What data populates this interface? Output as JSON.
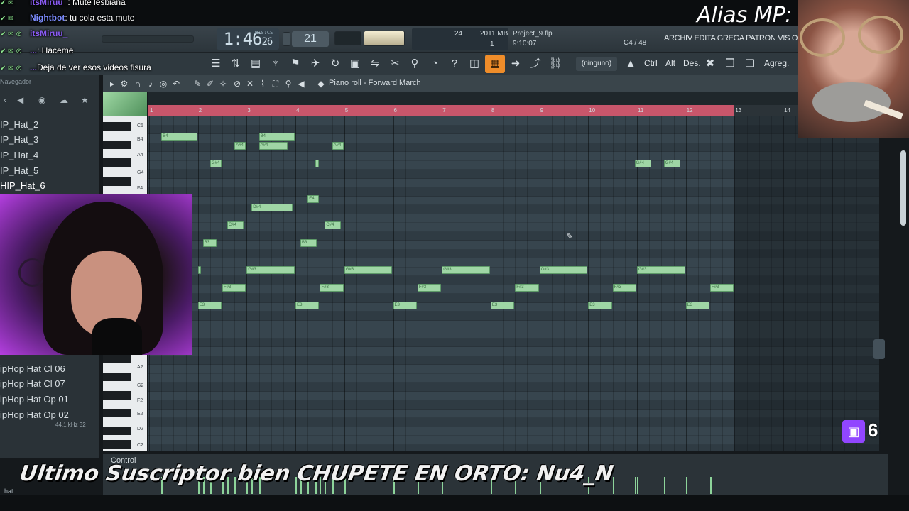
{
  "overlay": {
    "chat": [
      {
        "badges": "✔ ✉",
        "user": "itsMiruu_",
        "user_color": "#8b5cf6",
        "message": ": Mute lesbiana"
      },
      {
        "badges": "✔ ✉",
        "user": "Nightbot",
        "user_color": "#7c8cff",
        "message": ": tu cola esta mute"
      },
      {
        "badges": "✔ ✉ ⊘",
        "user": "itsMiruu_",
        "user_color": "#8b5cf6",
        "message": ""
      },
      {
        "badges": "✔ ✉ ⊘",
        "user": "...",
        "user_color": "#8b5cf6",
        "message": ": Haceme"
      },
      {
        "badges": "✔ ✉ ⊘",
        "user": "...",
        "user_color": "#8b5cf6",
        "message": "Deja de ver esos videos fisura"
      }
    ],
    "alias_text": "Alias MP: c",
    "subscriber_banner": "Ultimo Suscriptor bien CHUPETE EN ORTO: Nu4_N",
    "viewer_count": "6",
    "twitch_icon": "twitch-logo-icon"
  },
  "fl_toolbar": {
    "song_time": "1:46",
    "song_time_ticks": "26",
    "time_format_label": "M:S:CS",
    "tempo_value": "21",
    "cpu": "24",
    "ram": "2011 MB",
    "polyphony": "1",
    "project_name": "Project_9.flp",
    "project_time": "9:10:07",
    "note_info": "C4 / 48",
    "menu": "ARCHIV EDITA GREGA PATRON VIS OPCIONES",
    "pattern_selector": "(ninguno)",
    "text_buttons": [
      "Ctrl",
      "Alt",
      "Des.",
      "Agreg."
    ]
  },
  "browser": {
    "header": "Navegador",
    "items_top": [
      "IP_Hat_2",
      "IP_Hat_3",
      "IP_Hat_4",
      "IP_Hat_5",
      "HIP_Hat_6"
    ],
    "selected_index": 4,
    "items_bottom": [
      "ipHop Hat Cl 06",
      "ipHop Hat Cl 07",
      "ipHop Hat Op 01",
      "ipHop Hat Op 02"
    ],
    "meta": "44.1 kHz 32",
    "bottom_label": "hat"
  },
  "piano_roll": {
    "title": "Piano roll - Forward March",
    "control_label": "Control",
    "bars": [
      "1",
      "2",
      "3",
      "4",
      "5",
      "6",
      "7",
      "8",
      "9",
      "10",
      "11",
      "12",
      "13",
      "14"
    ],
    "key_labels": [
      "C5",
      "B4",
      "A4",
      "G4",
      "F4",
      "A2",
      "G2",
      "F2",
      "E2",
      "D2",
      "C2"
    ],
    "notes": [
      {
        "label": "B4",
        "bar": 1.25,
        "len": 0.75,
        "pitch": "B4"
      },
      {
        "label": "B4",
        "bar": 3.25,
        "len": 0.75,
        "pitch": "B4"
      },
      {
        "label": "A#4",
        "bar": 2.75,
        "len": 0.25,
        "pitch": "A#4"
      },
      {
        "label": "A#4",
        "bar": 3.25,
        "len": 0.6,
        "pitch": "A#4"
      },
      {
        "label": "A#4",
        "bar": 4.75,
        "len": 0.25,
        "pitch": "A#4"
      },
      {
        "label": "G#4",
        "bar": 2.25,
        "len": 0.25,
        "pitch": "G#4"
      },
      {
        "label": "",
        "bar": 4.4,
        "len": 0.1,
        "pitch": "G#4"
      },
      {
        "label": "G#4",
        "bar": 10.95,
        "len": 0.35,
        "pitch": "G#4"
      },
      {
        "label": "G#4",
        "bar": 11.55,
        "len": 0.35,
        "pitch": "G#4"
      },
      {
        "label": "E4",
        "bar": 4.25,
        "len": 0.25,
        "pitch": "E4"
      },
      {
        "label": "D#4",
        "bar": 3.1,
        "len": 0.85,
        "pitch": "D#4"
      },
      {
        "label": "C#4",
        "bar": 2.6,
        "len": 0.35,
        "pitch": "C#4"
      },
      {
        "label": "C#4",
        "bar": 4.6,
        "len": 0.35,
        "pitch": "C#4"
      },
      {
        "label": "B3",
        "bar": 2.1,
        "len": 0.3,
        "pitch": "B3"
      },
      {
        "label": "B3",
        "bar": 4.1,
        "len": 0.35,
        "pitch": "B3"
      },
      {
        "label": "G#3",
        "bar": 2.0,
        "len": 0.05,
        "pitch": "G#3"
      },
      {
        "label": "G#3",
        "bar": 3.0,
        "len": 1.0,
        "pitch": "G#3"
      },
      {
        "label": "G#3",
        "bar": 5.0,
        "len": 1.0,
        "pitch": "G#3"
      },
      {
        "label": "G#3",
        "bar": 7.0,
        "len": 1.0,
        "pitch": "G#3"
      },
      {
        "label": "G#3",
        "bar": 9.0,
        "len": 1.0,
        "pitch": "G#3"
      },
      {
        "label": "G#3",
        "bar": 11.0,
        "len": 1.0,
        "pitch": "G#3"
      },
      {
        "label": "F#3",
        "bar": 2.5,
        "len": 0.5,
        "pitch": "F#3"
      },
      {
        "label": "F#3",
        "bar": 4.5,
        "len": 0.5,
        "pitch": "F#3"
      },
      {
        "label": "F#3",
        "bar": 6.5,
        "len": 0.5,
        "pitch": "F#3"
      },
      {
        "label": "F#3",
        "bar": 8.5,
        "len": 0.5,
        "pitch": "F#3"
      },
      {
        "label": "F#3",
        "bar": 10.5,
        "len": 0.5,
        "pitch": "F#3"
      },
      {
        "label": "F#3",
        "bar": 12.5,
        "len": 0.5,
        "pitch": "F#3"
      },
      {
        "label": "E3",
        "bar": 2.0,
        "len": 0.5,
        "pitch": "E3"
      },
      {
        "label": "E3",
        "bar": 4.0,
        "len": 0.5,
        "pitch": "E3"
      },
      {
        "label": "E3",
        "bar": 6.0,
        "len": 0.5,
        "pitch": "E3"
      },
      {
        "label": "E3",
        "bar": 8.0,
        "len": 0.5,
        "pitch": "E3"
      },
      {
        "label": "E3",
        "bar": 10.0,
        "len": 0.5,
        "pitch": "E3"
      },
      {
        "label": "E3",
        "bar": 12.0,
        "len": 0.5,
        "pitch": "E3"
      }
    ],
    "pitch_rows": {
      "B4": 0,
      "A#4": 1,
      "G#4": 3,
      "E4": 7,
      "D#4": 8,
      "C#4": 10,
      "B3": 12,
      "G#3": 15,
      "F#3": 17,
      "E3": 19
    },
    "active_color": "#ef8d2a",
    "note_color": "#9fd6a5",
    "loop_color": "#c8566b"
  }
}
